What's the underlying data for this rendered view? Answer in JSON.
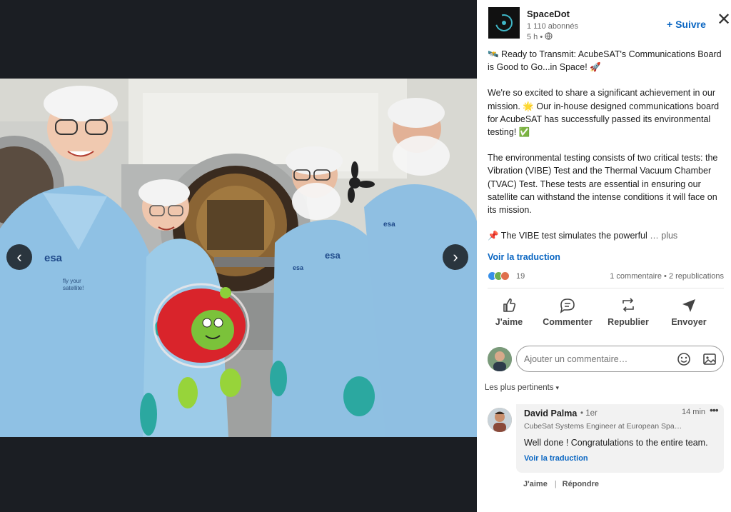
{
  "viewer": {
    "prev_icon": "chevron-left-icon",
    "prev_glyph": "‹",
    "next_icon": "chevron-right-icon",
    "next_glyph": "›",
    "photo_text": {
      "esa_1": "esa",
      "esa_2": "esa",
      "esa_3": "esa",
      "esa_4": "esa",
      "fly_line1": "fly your",
      "fly_line2": "satellite!"
    }
  },
  "post": {
    "author": "SpaceDot",
    "followers": "1 110 abonnés",
    "time": "5 h •",
    "follow_label": "+ Suivre",
    "close_glyph": "✕",
    "paragraphs": [
      "🛰️ Ready to Transmit: AcubeSAT's Communications Board is Good to Go...in Space! 🚀",
      "We're so excited to share a significant achievement in our mission. 🌟 Our in-house designed communications board for AcubeSAT has successfully passed its environmental testing! ✅",
      "The environmental testing consists of two critical tests: the Vibration (VIBE) Test and the Thermal Vacuum Chamber (TVAC) Test. These tests are essential in ensuring our satellite can withstand the intense conditions it will face on its mission."
    ],
    "last_line": "📌 The VIBE test simulates the powerful",
    "more_label": "… plus",
    "translate_label": "Voir la traduction"
  },
  "stats": {
    "reaction_count": "19",
    "summary": "1 commentaire • 2 republications"
  },
  "actions": [
    {
      "label": "J'aime",
      "icon": "thumbs-up-icon"
    },
    {
      "label": "Commenter",
      "icon": "comment-icon"
    },
    {
      "label": "Republier",
      "icon": "repost-icon"
    },
    {
      "label": "Envoyer",
      "icon": "send-icon"
    }
  ],
  "comment_box": {
    "placeholder": "Ajouter un commentaire…"
  },
  "sort": {
    "label": "Les plus pertinents",
    "caret": "▾"
  },
  "comments": [
    {
      "author": "David Palma",
      "degree": "• 1er",
      "time": "14 min",
      "menu": "•••",
      "headline": "CubeSat Systems Engineer at European Spa…",
      "text": "Well done ! Congratulations to the entire team.",
      "translate_label": "Voir la traduction",
      "like_label": "J'aime",
      "reply_label": "Répondre",
      "separator": "|"
    }
  ],
  "colors": {
    "brand_blue": "#0a66c2",
    "viewer_bg": "#1b1e23",
    "logo_teal": "#3fb7c7"
  }
}
